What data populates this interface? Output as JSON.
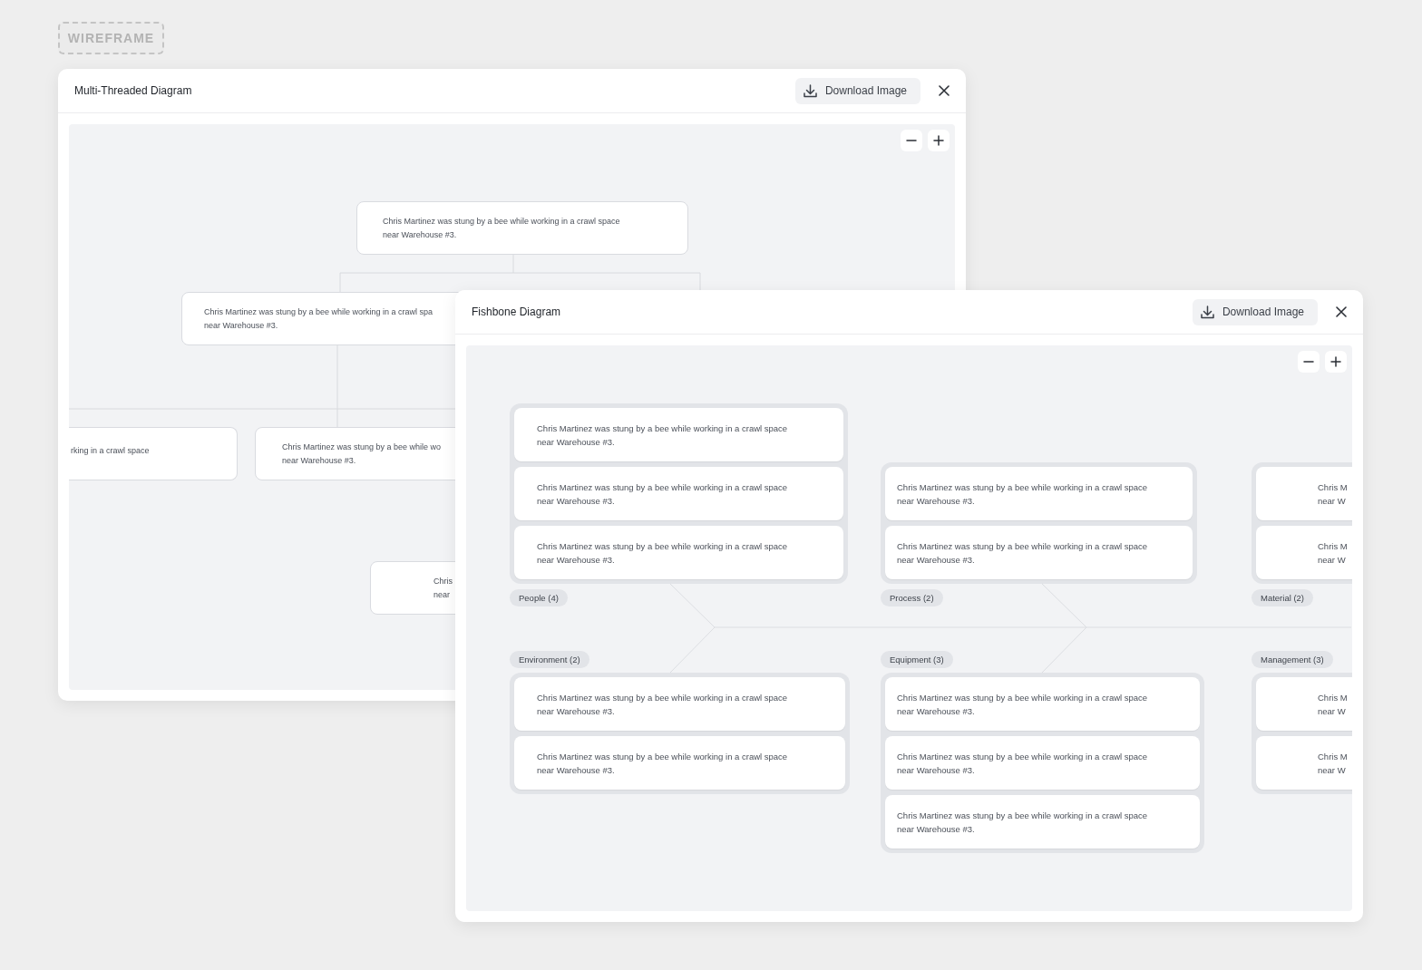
{
  "badge": "WIREFRAME",
  "windows": [
    {
      "kind": "tree",
      "title": "Multi-Threaded Diagram",
      "download_label": "Download Image",
      "tree": {
        "lines": [
          "Chris Martinez was stung by a bee while working in a crawl space",
          "near Warehouse #3."
        ],
        "children": [
          {
            "lines": [
              "Chris Martinez was stung by a bee while working in a crawl spa",
              "near Warehouse #3."
            ],
            "children": [
              {
                "lines": [
                  "rking in a crawl space"
                ]
              },
              {
                "lines": [
                  "Chris Martinez was stung by a bee while wo",
                  "near Warehouse #3."
                ],
                "children": [
                  {
                    "lines": [
                      "Chris",
                      "near"
                    ]
                  }
                ]
              }
            ]
          }
        ]
      }
    },
    {
      "kind": "fishbone",
      "title": "Fishbone Diagram",
      "download_label": "Download Image",
      "categories": [
        {
          "label": "People (4)",
          "kind": "top",
          "causes": [
            {
              "lines": [
                "Chris Martinez was stung by a bee while working in a crawl space",
                "near Warehouse #3."
              ]
            },
            {
              "lines": [
                "Chris Martinez was stung by a bee while working in a crawl space",
                "near Warehouse #3."
              ]
            },
            {
              "lines": [
                "Chris Martinez was stung by a bee while working in a crawl space",
                "near Warehouse #3."
              ]
            }
          ]
        },
        {
          "label": "Process (2)",
          "kind": "top",
          "causes": [
            {
              "lines": [
                "Chris Martinez was stung by a bee while working in a crawl space",
                "near Warehouse #3."
              ]
            },
            {
              "lines": [
                "Chris Martinez was stung by a bee while working in a crawl space",
                "near Warehouse #3."
              ]
            }
          ]
        },
        {
          "label": "Material (2)",
          "kind": "top",
          "causes": [
            {
              "lines": [
                "Chris M",
                "near W"
              ]
            },
            {
              "lines": [
                "Chris M",
                "near W"
              ]
            }
          ]
        },
        {
          "label": "Environment (2)",
          "kind": "bottom",
          "causes": [
            {
              "lines": [
                "Chris Martinez was stung by a bee while working in a crawl space",
                "near Warehouse #3."
              ]
            },
            {
              "lines": [
                "Chris Martinez was stung by a bee while working in a crawl space",
                "near Warehouse #3."
              ]
            }
          ]
        },
        {
          "label": "Equipment (3)",
          "kind": "bottom",
          "causes": [
            {
              "lines": [
                "Chris Martinez was stung by a bee while working in a crawl space",
                "near Warehouse #3."
              ]
            },
            {
              "lines": [
                "Chris Martinez was stung by a bee while working in a crawl space",
                "near Warehouse #3."
              ]
            },
            {
              "lines": [
                "Chris Martinez was stung by a bee while working in a crawl space",
                "near Warehouse #3."
              ]
            }
          ]
        },
        {
          "label": "Management (3)",
          "kind": "bottom",
          "causes": [
            {
              "lines": [
                "Chris M",
                "near W"
              ]
            },
            {
              "lines": [
                "Chris M",
                "near W"
              ]
            }
          ]
        }
      ]
    }
  ]
}
